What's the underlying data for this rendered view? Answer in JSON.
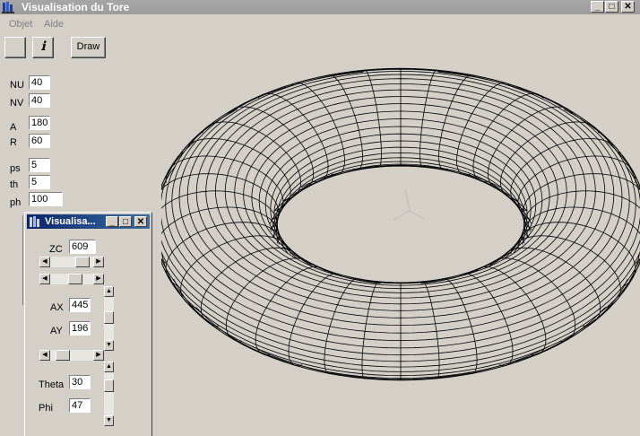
{
  "window": {
    "title": "Visualisation du Tore",
    "min_glyph": "_",
    "max_glyph": "□",
    "close_glyph": "✕"
  },
  "menu": {
    "items": [
      "Objet",
      "Aide"
    ]
  },
  "toolbar": {
    "draw_label": "Draw",
    "help_glyph": "ℹ"
  },
  "params": {
    "nu": {
      "label": "NU",
      "value": "40"
    },
    "nv": {
      "label": "NV",
      "value": "40"
    },
    "a": {
      "label": "A",
      "value": "180"
    },
    "r": {
      "label": "R",
      "value": "60"
    },
    "ps": {
      "label": "ps",
      "value": "5"
    },
    "th": {
      "label": "th",
      "value": "5"
    },
    "ph": {
      "label": "ph",
      "value": "100"
    }
  },
  "child": {
    "title": "Visualisa...",
    "zc": {
      "label": "ZC",
      "value": "609"
    },
    "ax": {
      "label": "AX",
      "value": "445"
    },
    "ay": {
      "label": "AY",
      "value": "196"
    },
    "theta": {
      "label": "Theta",
      "value": "30"
    },
    "phi": {
      "label": "Phi",
      "value": "47"
    }
  },
  "colors": {
    "titlebar_inactive": "#a6a6a6",
    "child_titlebar": "#0a246a",
    "face": "#d4d0c8"
  }
}
